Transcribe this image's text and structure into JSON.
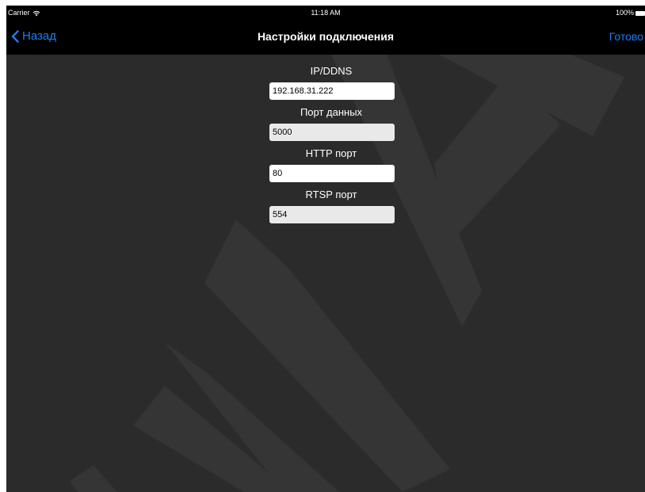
{
  "status_bar": {
    "carrier": "Carrier",
    "wifi_icon": "wifi-icon",
    "time": "11:18 AM",
    "battery": "100%",
    "battery_icon": "battery-icon"
  },
  "nav": {
    "back_label": "Назад",
    "back_icon": "chevron-left-icon",
    "title": "Настройки подключения",
    "done_label": "Готово"
  },
  "form": {
    "fields": [
      {
        "label": "IP/DDNS",
        "value": "192.168.31.222",
        "editable": true
      },
      {
        "label": "Порт данных",
        "value": "5000",
        "editable": false
      },
      {
        "label": "HTTP порт",
        "value": "80",
        "editable": true
      },
      {
        "label": "RTSP порт",
        "value": "554",
        "editable": false
      }
    ]
  },
  "colors": {
    "accent": "#1a7ef5",
    "background": "#2b2b2b",
    "bar": "#000000",
    "watermark": "#383838"
  }
}
